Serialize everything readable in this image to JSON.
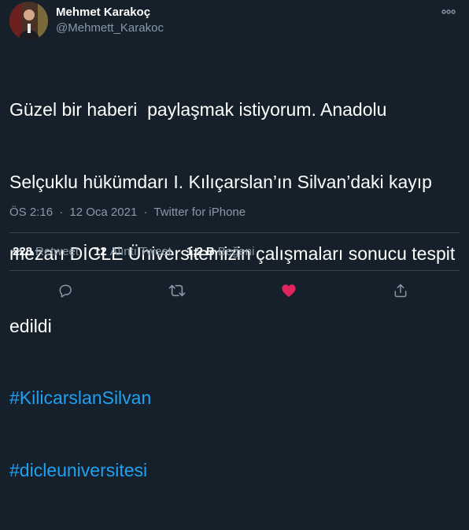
{
  "author": {
    "name": "Mehmet Karakoç",
    "handle": "@Mehmett_Karakoc"
  },
  "tweet": {
    "lines": [
      "Güzel bir haberi  paylaşmak istiyorum. Anadolu",
      "Selçuklu hükümdarı I. Kılıçarslan’ın Silvan’daki kayıp",
      "mezarı DİCLE Üniversitemizin çalışmaları sonucu tespit",
      "edildi"
    ],
    "hashtags": [
      "#KilicarslanSilvan",
      "#dicleuniversitesi"
    ]
  },
  "meta": {
    "time": "ÖS 2:16",
    "date": "12 Oca 2021",
    "source": "Twitter for iPhone",
    "separator": "·"
  },
  "stats": {
    "retweets": {
      "count": "228",
      "label": "Retweet"
    },
    "quotes": {
      "count": "12",
      "label": "Alıntı Tweet"
    },
    "likes": {
      "count": "1,2 B",
      "label": "Beğeni"
    }
  },
  "colors": {
    "background": "#15202b",
    "link": "#1da1f2",
    "muted": "#8899a6",
    "like_active": "#e0245e"
  },
  "icons": {
    "more": "more-horizontal-icon",
    "reply": "reply-icon",
    "retweet": "retweet-icon",
    "like": "heart-filled-icon",
    "share": "share-icon"
  }
}
